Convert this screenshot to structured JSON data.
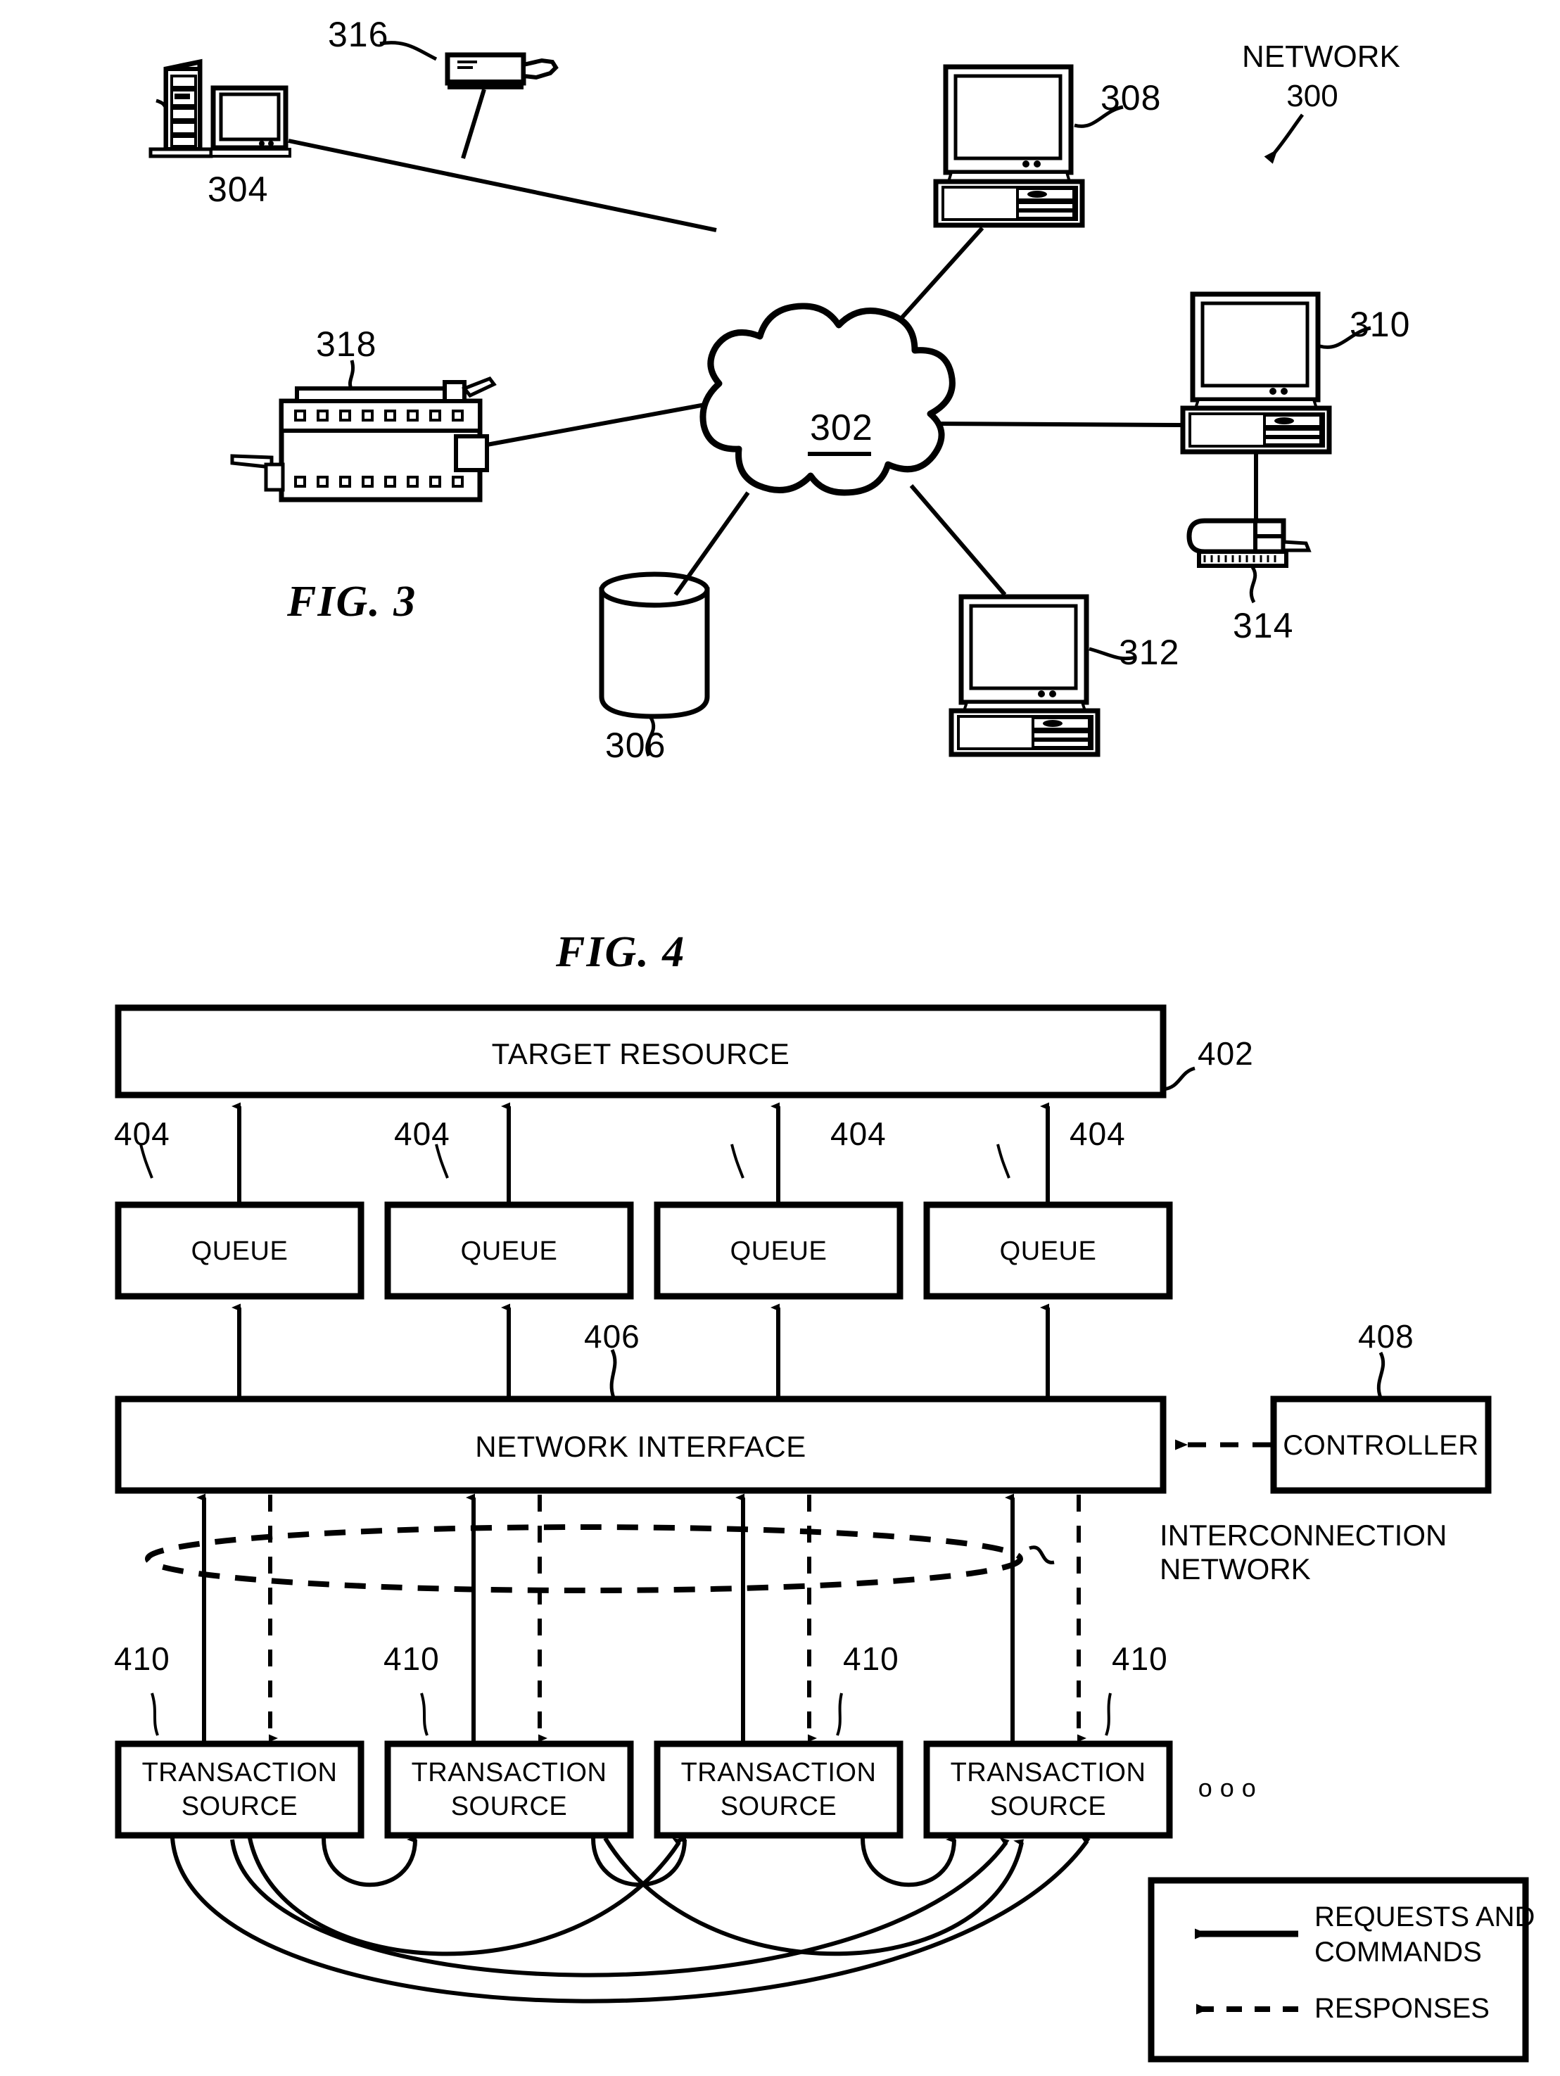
{
  "figures": {
    "fig3": {
      "label": "FIG. 3",
      "network_label_line1": "NETWORK",
      "network_label_line2": "300",
      "cloud_ref": "302",
      "refs": {
        "server_304": "304",
        "database_306": "306",
        "computer_308": "308",
        "computer_310": "310",
        "computer_312": "312",
        "storage_314": "314",
        "modem_316": "316",
        "printer_318": "318"
      }
    },
    "fig4": {
      "label": "FIG. 4",
      "target_resource": {
        "title": "TARGET RESOURCE",
        "ref": "402"
      },
      "queues": [
        {
          "title": "QUEUE",
          "ref": "404"
        },
        {
          "title": "QUEUE",
          "ref": "404"
        },
        {
          "title": "QUEUE",
          "ref": "404"
        },
        {
          "title": "QUEUE",
          "ref": "404"
        }
      ],
      "network_interface": {
        "title": "NETWORK INTERFACE",
        "ref": "406"
      },
      "controller": {
        "title": "CONTROLLER",
        "ref": "408"
      },
      "interconnection_network": {
        "line1": "INTERCONNECTION",
        "line2": "NETWORK"
      },
      "transaction_sources": [
        {
          "line1": "TRANSACTION",
          "line2": "SOURCE",
          "ref": "410"
        },
        {
          "line1": "TRANSACTION",
          "line2": "SOURCE",
          "ref": "410"
        },
        {
          "line1": "TRANSACTION",
          "line2": "SOURCE",
          "ref": "410"
        },
        {
          "line1": "TRANSACTION",
          "line2": "SOURCE",
          "ref": "410"
        }
      ],
      "ellipsis": "o  o  o",
      "legend": {
        "requests_line1": "REQUESTS AND",
        "requests_line2": "COMMANDS",
        "responses": "RESPONSES"
      }
    }
  },
  "colors": {
    "ink": "#000000",
    "paper": "#ffffff"
  }
}
